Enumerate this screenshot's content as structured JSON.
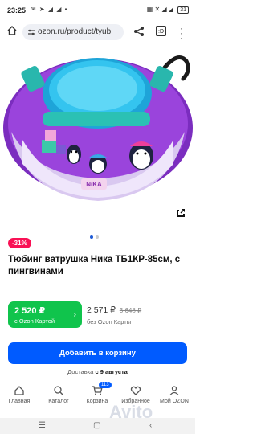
{
  "status_bar": {
    "time": "23:25",
    "battery": "31"
  },
  "browser": {
    "url": "ozon.ru/product/tyub"
  },
  "carousel": {
    "active_index": 0,
    "count": 2
  },
  "product": {
    "discount": "-31%",
    "title": "Тюбинг ватрушка Ника ТБ1КР-85см, с пингвинами",
    "image_text": "NiKA"
  },
  "pricing": {
    "ozon_card_price": "2 520 ₽",
    "ozon_card_label": "с Ozon Картой",
    "regular_price": "2 571 ₽",
    "old_price": "3 648 ₽",
    "regular_label": "без Ozon Карты"
  },
  "cart": {
    "add_label": "Добавить в корзину"
  },
  "delivery": {
    "prefix": "Доставка",
    "date": "с 9 августа"
  },
  "bottom_nav": {
    "items": [
      {
        "label": "Главная",
        "icon": "home-icon"
      },
      {
        "label": "Каталог",
        "icon": "catalog-icon"
      },
      {
        "label": "Корзина",
        "icon": "cart-icon",
        "badge": "113"
      },
      {
        "label": "Избранное",
        "icon": "heart-icon"
      },
      {
        "label": "Мой OZON",
        "icon": "profile-icon"
      }
    ]
  },
  "watermark": "Avito",
  "colors": {
    "accent": "#005bff",
    "ozon_green": "#10c44c",
    "discount": "#f91155"
  }
}
